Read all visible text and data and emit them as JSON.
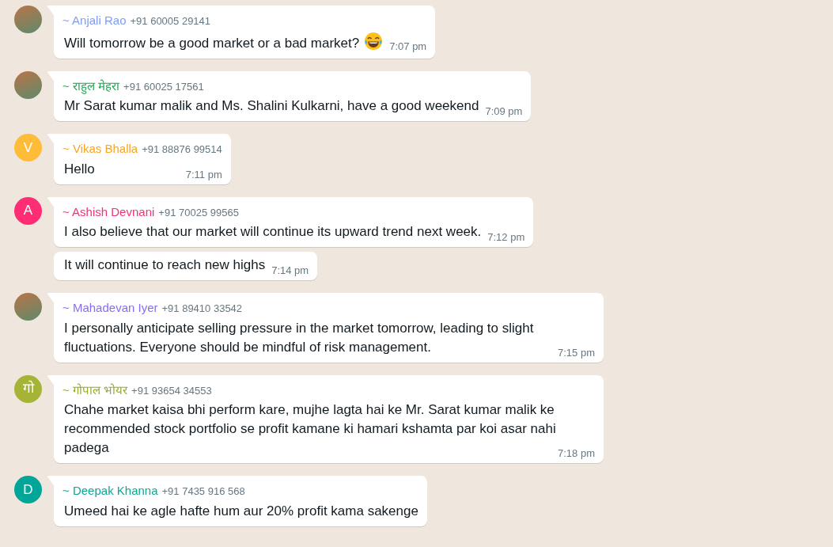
{
  "messages": [
    {
      "avatar": {
        "kind": "photo"
      },
      "sender": {
        "name": "~ Anjali Rao",
        "phone": "+91 60005 29141",
        "color": "#7f9cf5"
      },
      "text": "Will tomorrow be a good market or a bad market?",
      "emoji": true,
      "time": "7:07 pm"
    },
    {
      "avatar": {
        "kind": "photo"
      },
      "sender": {
        "name": "~ राहुल मेहरा",
        "phone": "+91 60025 17561",
        "color": "#1fa855"
      },
      "text": "Mr Sarat kumar malik and Ms. Shalini Kulkarni, have a good weekend",
      "time": "7:09 pm"
    },
    {
      "avatar": {
        "kind": "letter",
        "letter": "V",
        "color": "#ffbc38"
      },
      "sender": {
        "name": "~ Vikas Bhalla",
        "phone": "+91 88876 99514",
        "color": "#f5a623"
      },
      "text": "Hello",
      "time": "7:11 pm"
    },
    {
      "avatar": {
        "kind": "letter",
        "letter": "A",
        "color": "#ff2e74"
      },
      "sender": {
        "name": "~ Ashish Devnani",
        "phone": "+91 70025 99565",
        "color": "#f0337a"
      },
      "text": "I also believe that our market will continue its upward trend next week.",
      "time": "7:12 pm"
    },
    {
      "avatar": {
        "kind": "none"
      },
      "text": "It will continue to reach new highs",
      "time": "7:14 pm"
    },
    {
      "avatar": {
        "kind": "photo"
      },
      "sender": {
        "name": "~ Mahadevan Iyer",
        "phone": "+91 89410 33542",
        "color": "#8b6cf0"
      },
      "text": "I personally anticipate selling pressure in the market tomorrow, leading to slight fluctuations. Everyone should be mindful of risk management.",
      "time": "7:15 pm"
    },
    {
      "avatar": {
        "kind": "letter",
        "letter": "गो",
        "color": "#a5b337"
      },
      "sender": {
        "name": "~ गोपाल भोयर",
        "phone": "+91 93654 34553",
        "color": "#9aab2c"
      },
      "text": "Chahe market kaisa bhi perform kare, mujhe lagta hai ke Mr. Sarat kumar malik ke recommended stock portfolio se profit kamane ki hamari kshamta par koi asar nahi padega",
      "time": "7:18 pm"
    },
    {
      "avatar": {
        "kind": "letter",
        "letter": "D",
        "color": "#02a698"
      },
      "sender": {
        "name": "~ Deepak Khanna",
        "phone": "+91 7435 916 568",
        "color": "#10a595"
      },
      "text": "Umeed hai ke agle hafte hum aur 20% profit kama sakenge"
    }
  ]
}
